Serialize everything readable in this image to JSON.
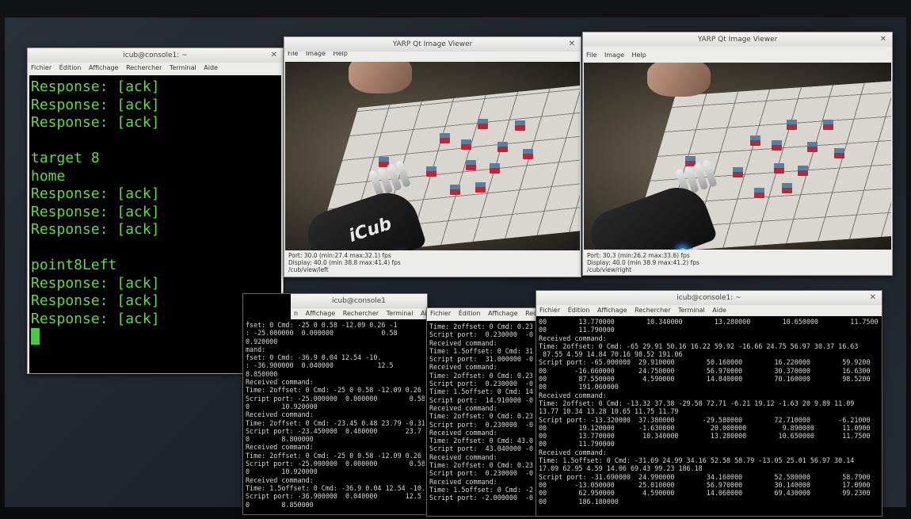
{
  "terminal_main": {
    "title": "icub@console1: ~",
    "menu": [
      "Fichier",
      "Édition",
      "Affichage",
      "Rechercher",
      "Terminal",
      "Aide"
    ],
    "lines": [
      "Response: [ack]",
      "Response: [ack]",
      "Response: [ack]",
      "",
      "target 8",
      "home",
      "Response: [ack]",
      "Response: [ack]",
      "Response: [ack]",
      "",
      "point8Left",
      "Response: [ack]",
      "Response: [ack]",
      "Response: [ack]"
    ]
  },
  "viewer_left": {
    "title": "YARP Qt Image Viewer",
    "menu": [
      "File",
      "Image",
      "Help"
    ],
    "status": [
      "Port: 30.0 (min:27.4 max:32.1) fps",
      "Display: 40.0 (min 38.8 max:41.4) fps",
      "/cub/view/left"
    ]
  },
  "viewer_right": {
    "title": "YARP Qt Image Viewer",
    "menu": [
      "File",
      "Image",
      "Help"
    ],
    "status": [
      "Port: 30.3 (min:26.2 max:33.6) fps",
      "Display: 40.0 (min 38.9 max:41.2) fps",
      "/cub/view/right"
    ]
  },
  "robot_logo": "iCub",
  "term_a": {
    "title": "icub@console1",
    "menu": [
      "n",
      "Affichage",
      "Rechercher",
      "Terminal",
      "Aide"
    ],
    "lines": [
      "fset: 0 Cmd: -25 0 0.58 -12.09 0.26 -1",
      ": -25.000000  0.000000            0.58",
      "0.920000",
      "mand:",
      "fset: 0 Cmd: -36.9 0.04 12.54 -10.",
      ": -36.900000  0.040000           12.5",
      "8.850000",
      "Received command:",
      "Time: 2offset: 0 Cmd: -25 0 0.58 -12.09 0.26 -1",
      "Script port: -25.000000  0.000000        0.58",
      "0        10.920000",
      "Received command:",
      "Time: 2offset: 0 Cmd: -23.45 0.48 23.79 -0.31",
      "Script port: -23.450000  0.480000       23.7",
      "0        8.800000",
      "Received command:",
      "Time: 2offset: 0 Cmd: -25 0 0.58 -12.09 0.26",
      "Script port: -25.000000  0.000000        0.58",
      "0        10.920000",
      "Received command:",
      "Time: 1.5offset: 0 Cmd: -36.9 0.04 12.54 -10.",
      "Script port: -36.900000  0.040000       12.5",
      "0        8.850000",
      ""
    ]
  },
  "term_b": {
    "title": "",
    "menu": [
      "Fichier",
      "Édition",
      "Affichage",
      "Rech"
    ],
    "lines": [
      "Time: 2offset: 0 Cmd: 0.23",
      "Script port:  0.230000  -0",
      "Received command:",
      "Time: 1.5offset: 0 Cmd: 31",
      "Script port:  31.000000 -0",
      "Received command:",
      "Time: 2offset: 0 Cmd: 0.23",
      "Script port:  0.230000  -0",
      "Time: 1.5offset: 0 Cmd: 14",
      "Script port:  14.910000 -0",
      "Received command:",
      "Time: 2offset: 0 Cmd: 0.23",
      "Script port:  0.230000  -0",
      "Received command:",
      "Time: 2offset: 0 Cmd: 43.0",
      "Script port:  43.040000 -0",
      "Received command:",
      "Time: 2offset: 0 Cmd: 0.23",
      "Script port:  0.230000  -0",
      "Received command:",
      "Time: 1.5offset: 0 Cmd: -2",
      "Script port: -2.000000  -0",
      ""
    ]
  },
  "term_c": {
    "title": "icub@console1: ~",
    "menu": [
      "Fichier",
      "Édition",
      "Affichage",
      "Rechercher",
      "Terminal",
      "Aide"
    ],
    "lines": [
      "00        13.770000        10.340000        13.280000        10.650000        11.7500",
      "00        11.790000",
      "Received command:",
      "Time: 2offset: 0 Cmd: -65 29.91 50.16 16.22 59.92 -16.66 24.75 56.97 30.37 16.63",
      " 87.55 4.59 14.84 70.16 98.52 191.06",
      "Script port: -65.000000  29.910000        50.160000        16.220000        59.9200",
      "00       -16.660000      24.750000        56.970000        30.370000        16.6300",
      "00        87.550000       4.590000        14.840000        70.160000        98.5200",
      "00        191.060000",
      "Received command:",
      "Time: 2offset: 0 Cmd: -13.32 37.38 -29.58 72.71 -6.21 19.12 -1.63 20 9.89 11.09",
      "13.77 10.34 13.28 10.65 11.75 11.79",
      "Script port: -13.320000  37.380000       -29.580000        72.710000       -6.21000",
      "00        19.120000      -1.630000         20.000000         9.890000       11.0900",
      "00        13.770000       10.340000        13.280000        10.650000       11.7500",
      "00        11.790000",
      "Received command:",
      "Time: 1.5offset: 0 Cmd: -31.69 24.99 34.16 52.58 58.79 -13.05 25.01 56.97 30.14",
      "17.09 62.95 4.59 14.06 69.43 99.23 186.18",
      "Script port: -31.690000  24.990000        34.160000        52.580000        58.7900",
      "00       -13.050000      25.010000        56.970000        30.140000        17.0900",
      "00        62.950000       4.590000        14.060000        69.430000        99.2300",
      "00        186.180000",
      ""
    ]
  },
  "colors": {
    "terminal_green": "#5fdc3a",
    "terminal_bg": "#000000",
    "cube_red": "#b8283a",
    "cube_blue": "#4f84a8"
  }
}
